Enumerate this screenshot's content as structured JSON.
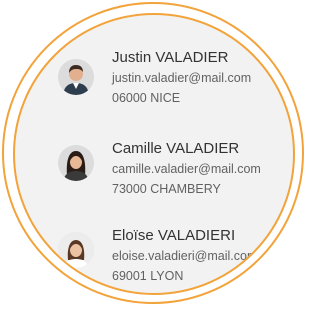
{
  "contacts": [
    {
      "name": "Justin VALADIER",
      "email": "justin.valadier@mail.com",
      "city": "06000 NICE",
      "avatar_icon": "man-portrait-avatar"
    },
    {
      "name": "Camille VALADIER",
      "email": "camille.valadier@mail.com",
      "city": "73000 CHAMBERY",
      "avatar_icon": "woman-portrait-avatar"
    },
    {
      "name": "Eloïse VALADIERI",
      "email": "eloise.valadieri@mail.com",
      "city": "69001 LYON",
      "avatar_icon": "woman-portrait-avatar"
    }
  ],
  "colors": {
    "ring": "#f2a33a",
    "background": "#f2f2f2",
    "name_text": "#333333",
    "secondary_text": "#616161"
  }
}
